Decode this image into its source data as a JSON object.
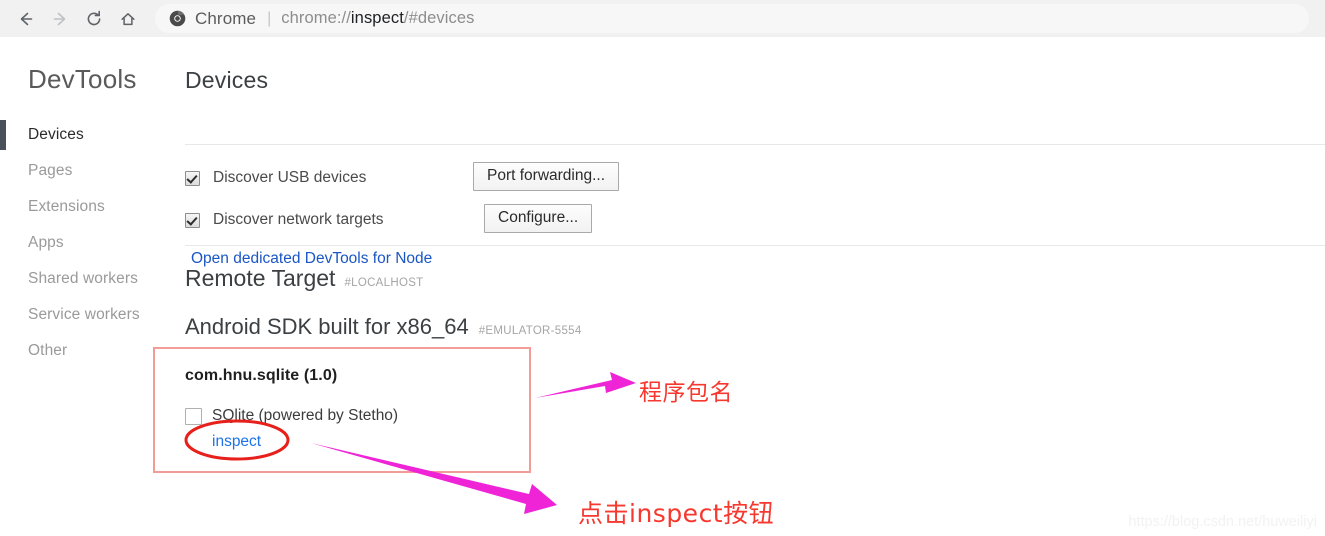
{
  "browser": {
    "nav": [
      {
        "name": "back",
        "icon": "arrow-left-icon",
        "enabled": true
      },
      {
        "name": "forward",
        "icon": "arrow-right-icon",
        "enabled": false
      },
      {
        "name": "reload",
        "icon": "reload-icon",
        "enabled": true
      },
      {
        "name": "home",
        "icon": "home-icon",
        "enabled": true
      }
    ],
    "omnibox": {
      "app_label": "Chrome",
      "separator": "|",
      "url_scheme": "chrome://",
      "url_host": "inspect",
      "url_path": "/#devices",
      "url_full": "chrome://inspect/#devices",
      "chrome_logo_icon": "chrome-logo-icon"
    }
  },
  "sidebar": {
    "title": "DevTools",
    "items": [
      {
        "label": "Devices",
        "selected": true
      },
      {
        "label": "Pages",
        "selected": false
      },
      {
        "label": "Extensions",
        "selected": false
      },
      {
        "label": "Apps",
        "selected": false
      },
      {
        "label": "Shared workers",
        "selected": false
      },
      {
        "label": "Service workers",
        "selected": false
      },
      {
        "label": "Other",
        "selected": false
      }
    ]
  },
  "main": {
    "title": "Devices",
    "options": [
      {
        "label": "Discover USB devices",
        "checked": true
      },
      {
        "label": "Discover network targets",
        "checked": true
      }
    ],
    "buttons": {
      "port_forwarding": "Port forwarding...",
      "configure": "Configure..."
    },
    "node_link": "Open dedicated DevTools for Node",
    "remote_target": {
      "title": "Remote Target",
      "tag": "#LOCALHOST"
    },
    "device": {
      "name": "Android SDK built for x86_64",
      "tag": "#EMULATOR-5554"
    },
    "app": {
      "title": "com.hnu.sqlite (1.0)",
      "target_label": "SQlite (powered by Stetho)",
      "target_checked": false,
      "inspect_label": "inspect"
    }
  },
  "annotations": {
    "box_color": "#f29b97",
    "text_color": "#f6382f",
    "arrow_color": "#ef24d7",
    "circle_color": "#e8201c",
    "callouts": [
      {
        "text": "程序包名",
        "target": "app-title"
      },
      {
        "text": "点击inspect按钮",
        "target": "inspect-link"
      }
    ],
    "watermark": "https://blog.csdn.net/huweiliyi"
  }
}
